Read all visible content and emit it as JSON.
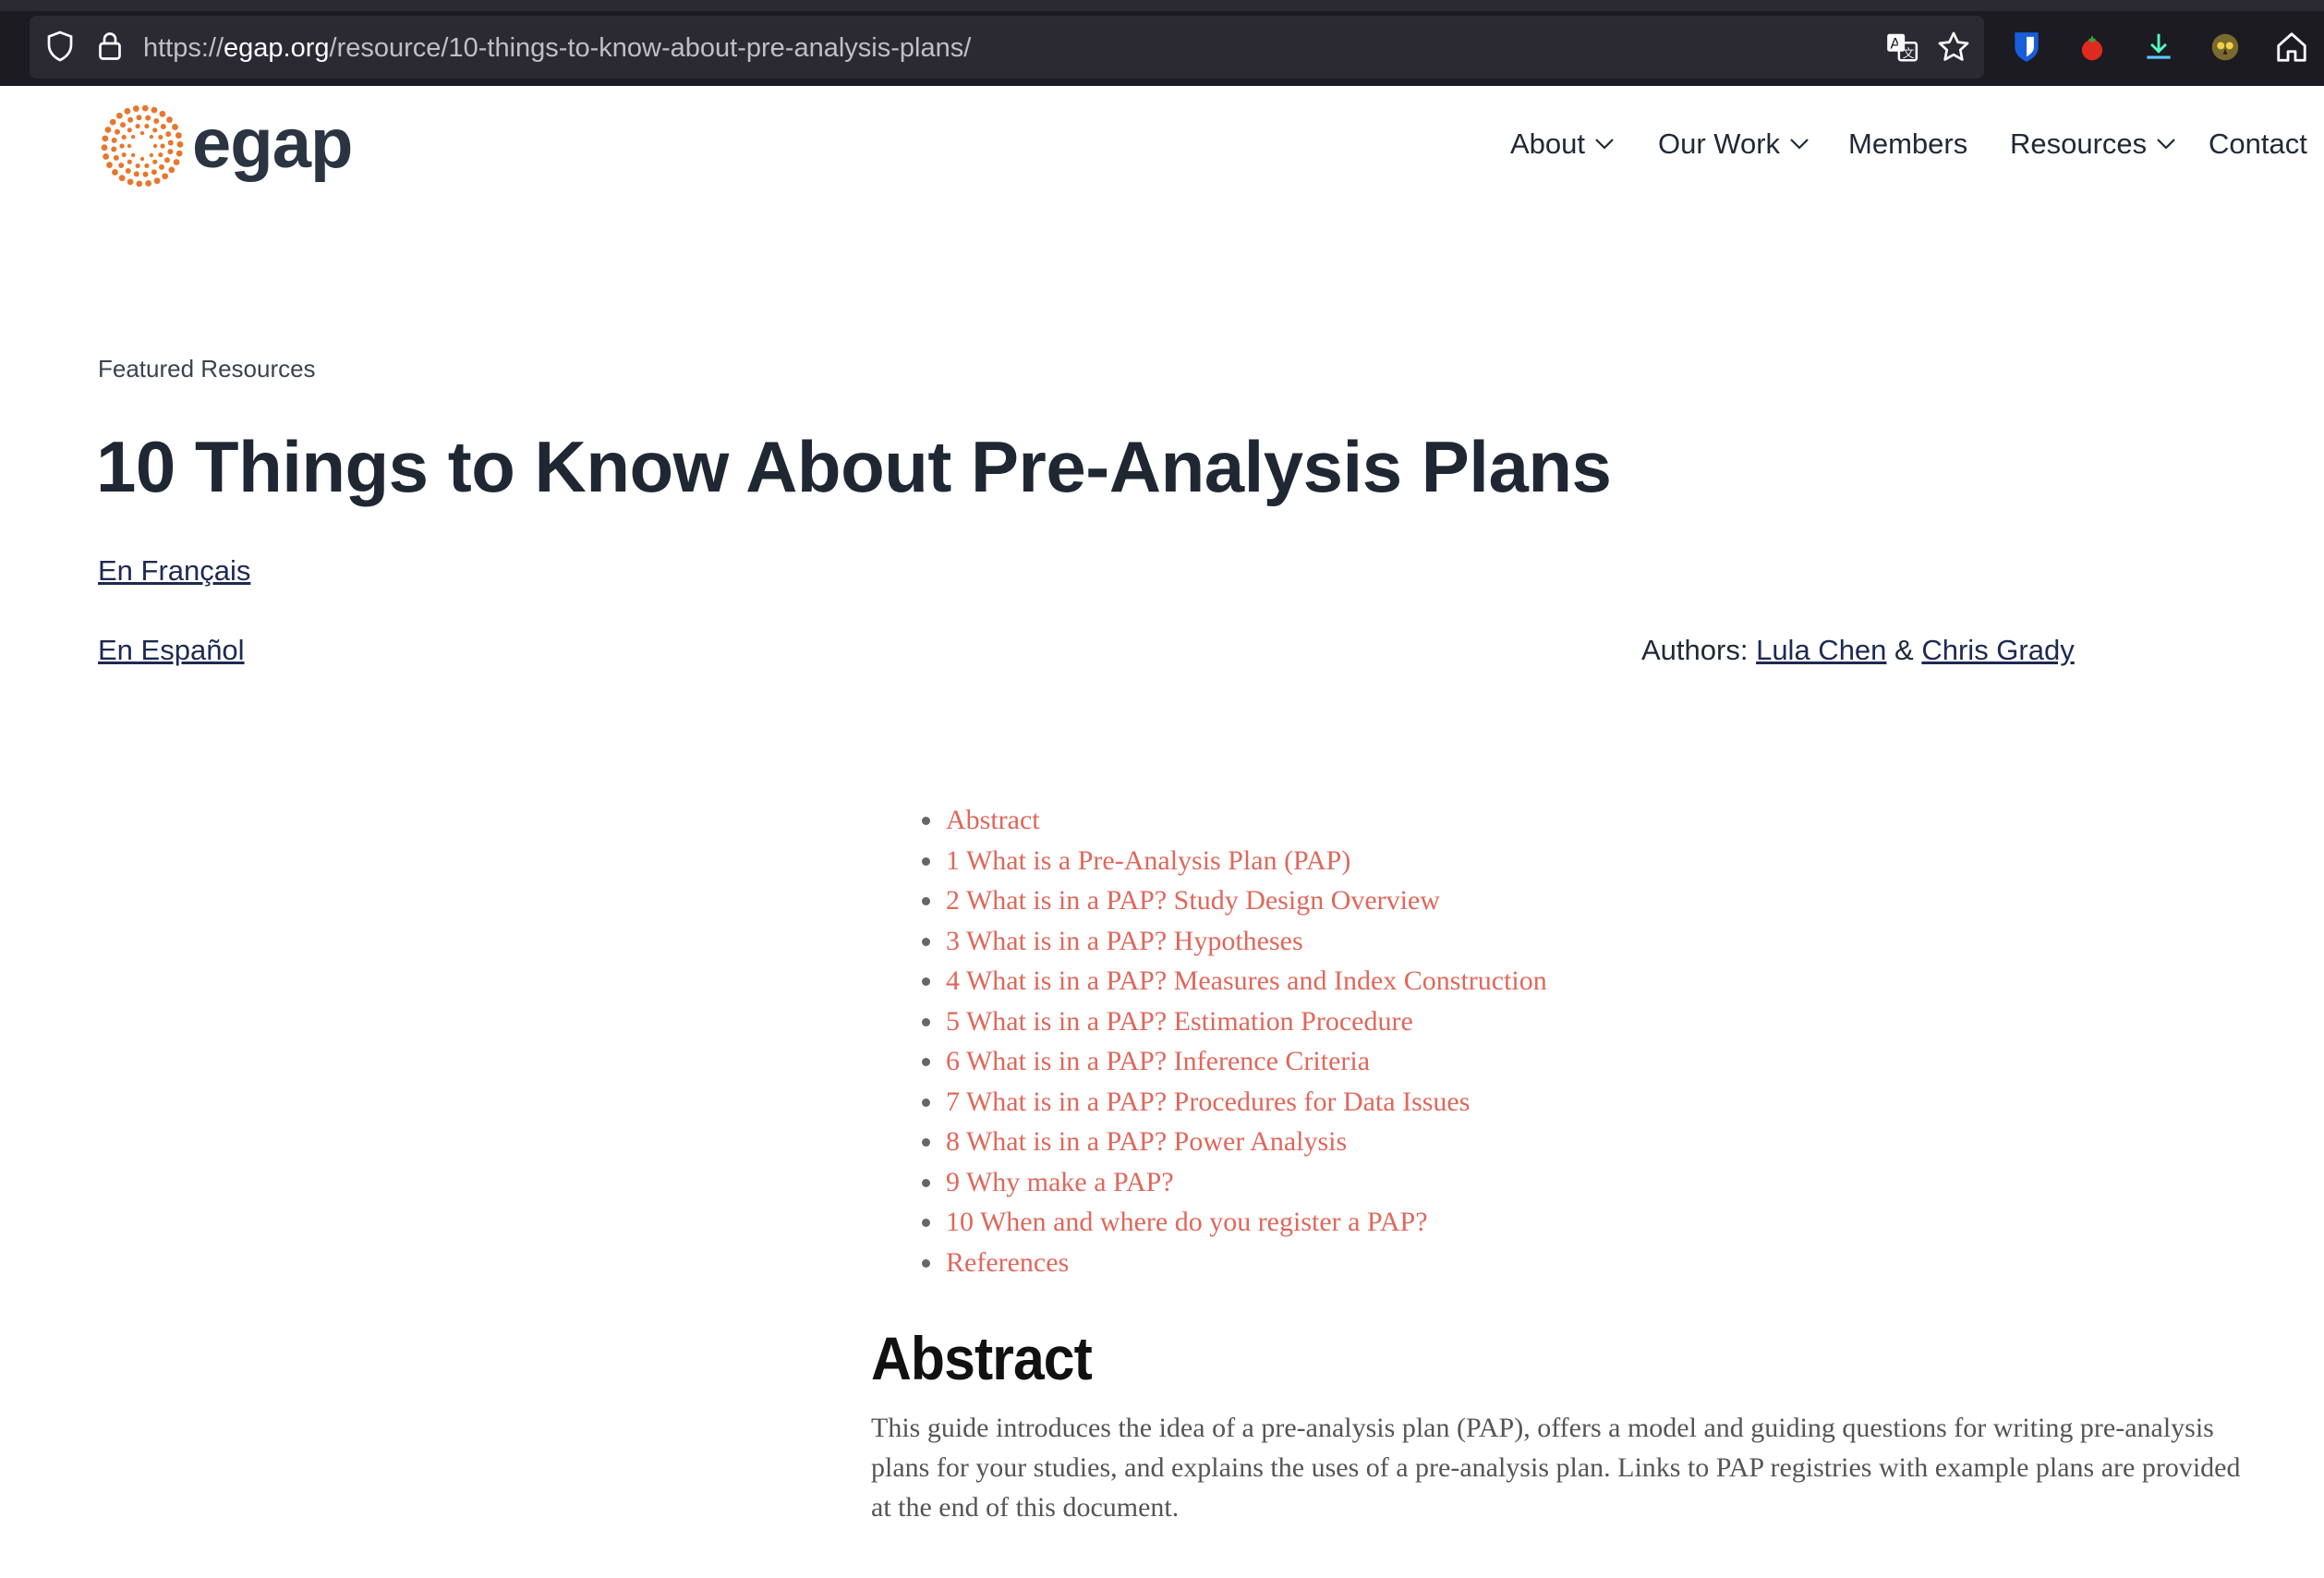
{
  "browser": {
    "url_prefix": "https://",
    "url_domain": "egap.org",
    "url_path": "/resource/10-things-to-know-about-pre-analysis-plans/"
  },
  "site": {
    "logo_text": "egap",
    "nav": [
      {
        "label": "About",
        "has_dropdown": true
      },
      {
        "label": "Our Work",
        "has_dropdown": true
      },
      {
        "label": "Members",
        "has_dropdown": false
      },
      {
        "label": "Resources",
        "has_dropdown": true
      },
      {
        "label": "Contact",
        "has_dropdown": false
      }
    ]
  },
  "article": {
    "eyebrow": "Featured Resources",
    "title": "10 Things to Know About Pre-Analysis Plans",
    "lang_fr": "En Français",
    "lang_es": "En Español",
    "authors_label": "Authors:",
    "author1": "Lula Chen",
    "authors_sep": "&",
    "author2": "Chris Grady",
    "toc": [
      "Abstract",
      "1 What is a Pre-Analysis Plan (PAP)",
      "2 What is in a PAP? Study Design Overview",
      "3 What is in a PAP? Hypotheses",
      "4 What is in a PAP? Measures and Index Construction",
      "5 What is in a PAP? Estimation Procedure",
      "6 What is in a PAP? Inference Criteria",
      "7 What is in a PAP? Procedures for Data Issues",
      "8 What is in a PAP? Power Analysis",
      "9 Why make a PAP?",
      "10 When and where do you register a PAP?",
      "References"
    ],
    "abstract_heading": "Abstract",
    "abstract_text": "This guide introduces the idea of a pre-analysis plan (PAP), offers a model and guiding questions for writing pre-analysis plans for your studies, and explains the uses of a pre-analysis plan. Links to PAP registries with example plans are provided at the end of this document."
  },
  "colors": {
    "link_accent": "#e0675a",
    "logo_orange": "#e8772e",
    "chrome_bg": "#1c1b22"
  }
}
